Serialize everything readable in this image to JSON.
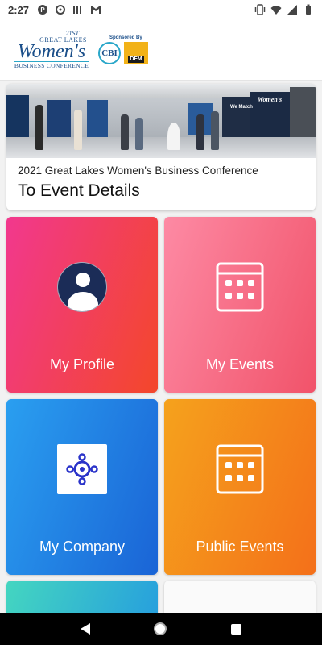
{
  "status_bar": {
    "time": "2:27",
    "left_icons": [
      "app-notification-icon",
      "settings-notification-icon",
      "signal-bars-icon",
      "gmail-icon"
    ],
    "right_icons": [
      "vibrate-icon",
      "wifi-icon",
      "cell-signal-icon",
      "battery-icon"
    ]
  },
  "header": {
    "logo": {
      "line1": "21ST",
      "line2": "GREAT LAKES",
      "line3": "Women's",
      "line4": "BUSINESS CONFERENCE"
    },
    "sponsor_label": "Sponsored By",
    "sponsor_logos": [
      {
        "name": "CBI",
        "text": "CBI"
      },
      {
        "name": "DFM",
        "text": "DFM"
      }
    ]
  },
  "event_card": {
    "title": "2021 Great Lakes Women's Business Conference",
    "link_label": "To Event Details",
    "banner_signs": [
      "We Match",
      "Women's"
    ]
  },
  "tiles": {
    "my_profile": {
      "label": "My Profile",
      "icon": "user-avatar-icon"
    },
    "my_events": {
      "label": "My Events",
      "icon": "calendar-icon"
    },
    "my_company": {
      "label": "My Company",
      "icon": "company-network-icon"
    },
    "public_events": {
      "label": "Public Events",
      "icon": "calendar-icon"
    }
  },
  "colors": {
    "profile_start": "#f2388e",
    "profile_end": "#f3472a",
    "events_start": "#fd8aa4",
    "events_end": "#f1536a",
    "company_start": "#2a9ff0",
    "company_end": "#1a64d6",
    "public_start": "#f5a21c",
    "public_end": "#f4701a",
    "brand_blue": "#1b4f8a"
  },
  "nav_bar": {
    "buttons": [
      "back-button",
      "home-button",
      "recents-button"
    ]
  }
}
